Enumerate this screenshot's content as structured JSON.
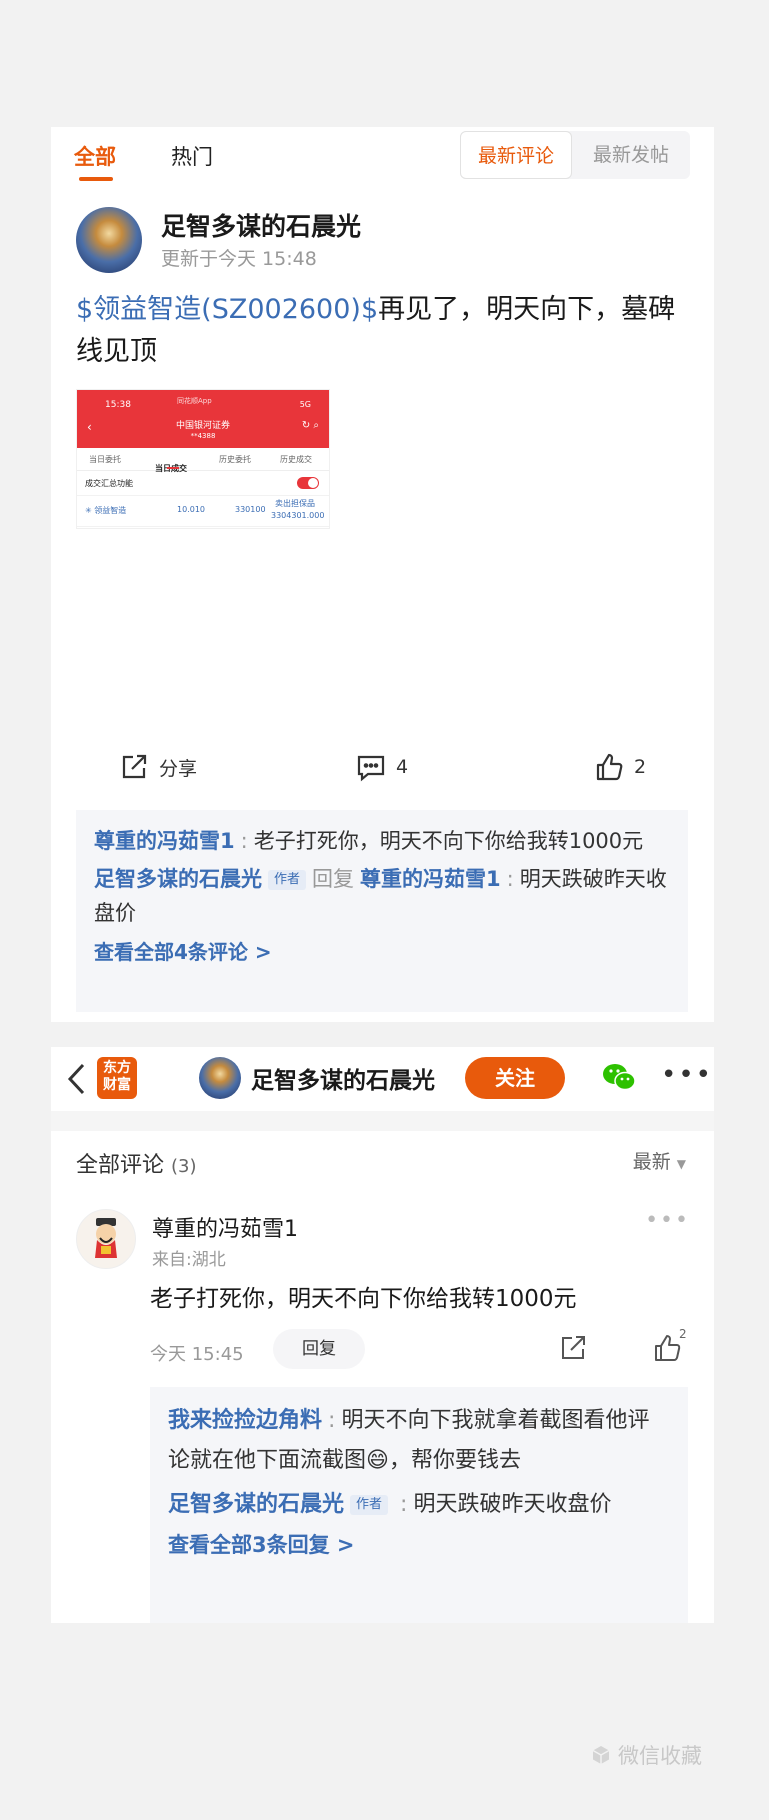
{
  "tabs": {
    "all": "全部",
    "hot": "热门"
  },
  "sort": {
    "latest_comment": "最新评论",
    "latest_post": "最新发帖"
  },
  "post": {
    "author": "足智多谋的石晨光",
    "updated": "更新于今天 15:48",
    "stock_tag": "$领益智造(SZ002600)$",
    "text": "再见了，明天向下，墓碑线见顶",
    "screenshot": {
      "time": "15:38",
      "app": "同花顺App",
      "signal": "5G",
      "broker": "中国银河证券",
      "account": "**4388",
      "tabs": [
        "当日委托",
        "当日成交",
        "历史委托",
        "历史成交"
      ],
      "summary_label": "成交汇总功能",
      "row": {
        "name": "领益智造",
        "price": "10.010",
        "qty": "330100",
        "type": "卖出担保品",
        "amount": "3304301.000"
      }
    },
    "actions": {
      "share": "分享",
      "comments": "4",
      "likes": "2"
    },
    "comments": [
      {
        "user": "尊重的冯茹雪1",
        "text": "老子打死你，明天不向下你给我转1000元"
      },
      {
        "user": "足智多谋的石晨光",
        "tag": "作者",
        "reply_word": "回复",
        "reply_to": "尊重的冯茹雪1",
        "text": "明天跌破昨天收盘价"
      }
    ],
    "view_all": "查看全部4条评论 >"
  },
  "detail": {
    "logo_line1": "东方",
    "logo_line2": "财富",
    "author": "足智多谋的石晨光",
    "follow": "关注",
    "all_comments": "全部评论",
    "count": "(3)",
    "sort": "最新",
    "comment": {
      "user": "尊重的冯茹雪1",
      "location": "来自:湖北",
      "text": "老子打死你，明天不向下你给我转1000元",
      "time": "今天 15:45",
      "reply_btn": "回复",
      "likes": "2"
    },
    "replies": [
      {
        "user": "我来捡捡边角料",
        "text1": "明天不向下我就拿着截图看他评论就在他下面流截图",
        "emoji": "😄",
        "text2": "，帮你要钱去"
      },
      {
        "user": "足智多谋的石晨光",
        "tag": "作者",
        "text": "明天跌破昨天收盘价"
      }
    ],
    "view_replies": "查看全部3条回复 >"
  },
  "watermark": "微信收藏",
  "colors": {
    "accent": "#e85a0c",
    "link": "#3b6db4"
  }
}
